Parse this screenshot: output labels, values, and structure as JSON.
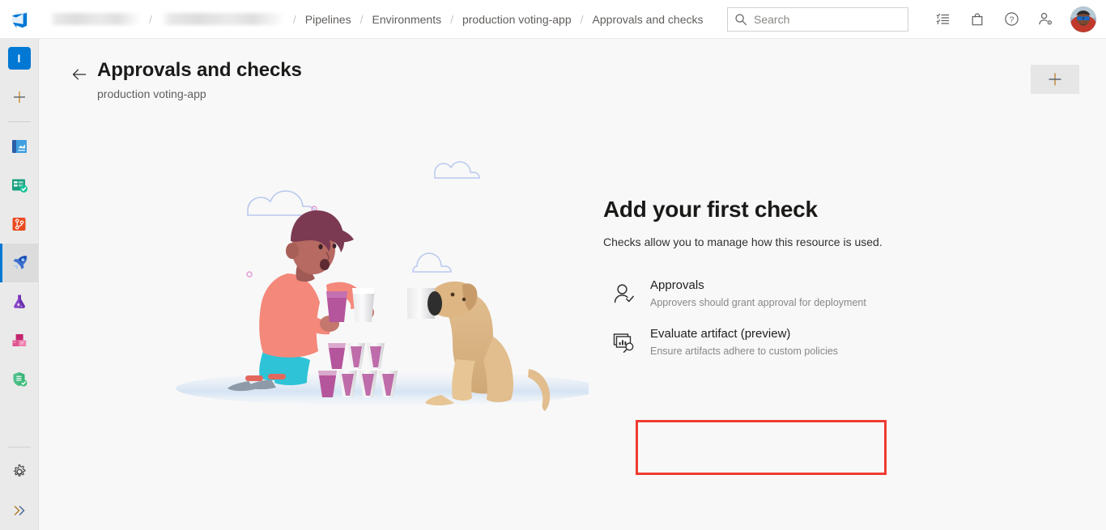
{
  "header": {
    "logo_icon": "azure-devops-logo",
    "breadcrumb": [
      {
        "type": "redacted",
        "label": ""
      },
      {
        "type": "redacted",
        "label": ""
      },
      {
        "type": "link",
        "label": "Pipelines"
      },
      {
        "type": "link",
        "label": "Environments"
      },
      {
        "type": "link",
        "label": "production voting-app"
      },
      {
        "type": "link",
        "label": "Approvals and checks"
      }
    ],
    "separator": "/",
    "search": {
      "placeholder": "Search",
      "value": "",
      "icon": "search-icon"
    },
    "icons": [
      {
        "name": "task-list-icon",
        "label": "Work items"
      },
      {
        "name": "shopping-bag-icon",
        "label": "Marketplace"
      },
      {
        "name": "help-icon",
        "label": "Help"
      },
      {
        "name": "user-settings-icon",
        "label": "User settings"
      }
    ],
    "avatar": {
      "name": "avatar",
      "label": "Account manager"
    }
  },
  "sidebar": {
    "project_badge": "I",
    "items": [
      {
        "name": "sidebar-item-project",
        "label": "I",
        "icon": "project-badge"
      },
      {
        "name": "sidebar-item-new",
        "label": "New",
        "icon": "plus-icon"
      },
      {
        "name": "sidebar-item-overview",
        "label": "Overview",
        "icon": "overview-icon"
      },
      {
        "name": "sidebar-item-boards",
        "label": "Boards",
        "icon": "boards-icon"
      },
      {
        "name": "sidebar-item-repos",
        "label": "Repos",
        "icon": "repos-icon"
      },
      {
        "name": "sidebar-item-pipelines",
        "label": "Pipelines",
        "icon": "pipelines-icon",
        "selected": true
      },
      {
        "name": "sidebar-item-test-plans",
        "label": "Test Plans",
        "icon": "test-plans-icon"
      },
      {
        "name": "sidebar-item-artifacts",
        "label": "Artifacts",
        "icon": "artifacts-icon"
      },
      {
        "name": "sidebar-item-advanced-security",
        "label": "Advanced Security",
        "icon": "shield-check-icon"
      }
    ],
    "bottom_items": [
      {
        "name": "sidebar-item-settings",
        "label": "Project settings",
        "icon": "gear-icon"
      },
      {
        "name": "sidebar-item-expand",
        "label": "Expand",
        "icon": "chevron-double-right-icon"
      }
    ]
  },
  "page": {
    "back_label": "Back",
    "title": "Approvals and checks",
    "subtitle": "production voting-app",
    "add_button_label": "+"
  },
  "panel": {
    "heading": "Add your first check",
    "subtitle": "Checks allow you to manage how this resource is used.",
    "checks": [
      {
        "name": "check-option-approvals",
        "icon": "person-check-icon",
        "title": "Approvals",
        "description": "Approvers should grant approval for deployment",
        "highlighted": false
      },
      {
        "name": "check-option-evaluate-artifact",
        "icon": "evaluate-artifact-icon",
        "title": "Evaluate artifact (preview)",
        "description": "Ensure artifacts adhere to custom policies",
        "highlighted": true
      }
    ]
  },
  "illustration": {
    "name": "cup-stacking-illustration",
    "description": "Person stacking cups with a dog and clouds"
  },
  "colors": {
    "accent": "#0078d4",
    "highlight": "#f03c32",
    "sidebar_bg": "#eaeaea",
    "content_bg": "#f8f8f8",
    "header_bg": "#ffffff"
  }
}
